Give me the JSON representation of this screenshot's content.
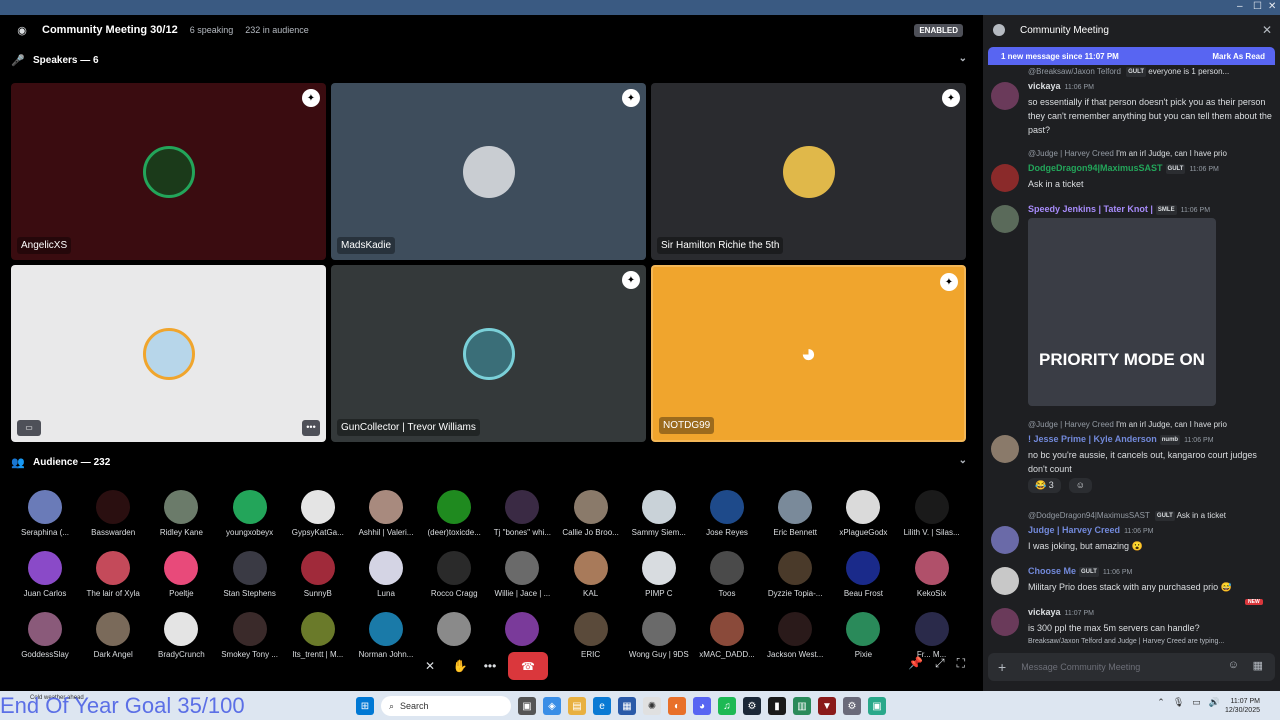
{
  "window": {
    "controls": [
      "–",
      "☐",
      "✕"
    ]
  },
  "stage": {
    "title": "Community Meeting 30/12",
    "speaking": "6 speaking",
    "audience": "232 in audience",
    "enabled_badge": "ENABLED",
    "speakers_heading": "Speakers — 6",
    "audience_heading": "Audience — 232"
  },
  "speakers": [
    {
      "name": "AngelicXS",
      "bg": "#3a0c10",
      "avatar": "#1b3a1a"
    },
    {
      "name": "MadsKadie",
      "bg": "#3e4d5c",
      "avatar": "#c9cdd2"
    },
    {
      "name": "Sir Hamilton Richie the 5th",
      "bg": "#2a2b2f",
      "avatar": "#e0b84a"
    },
    {
      "name": "",
      "bg": "#e9e9ea",
      "avatar": "#b7d6ea"
    },
    {
      "name": "GunCollector | Trevor Williams",
      "bg": "#34393a",
      "avatar": "#3a6e78"
    },
    {
      "name": "NOTDG99",
      "bg": "#f0a52d",
      "avatar": "#f0a52d"
    }
  ],
  "audience_rows": [
    [
      {
        "name": "Seraphina (...",
        "color": "#6a7bb8"
      },
      {
        "name": "Basswarden",
        "color": "#2a0f10"
      },
      {
        "name": "Ridley Kane",
        "color": "#6b7b6a"
      },
      {
        "name": "youngxobeyx",
        "color": "#23a55a"
      },
      {
        "name": "GypsyKatGa...",
        "color": "#e4e4e4"
      },
      {
        "name": "Ashhil | Valeri...",
        "color": "#a88a7e"
      },
      {
        "name": "(deer)toxicde...",
        "color": "#1f8a1f"
      },
      {
        "name": "Tj \"bones\" whi...",
        "color": "#3a2a44"
      },
      {
        "name": "Callie Jo Broo...",
        "color": "#8a7a6a"
      },
      {
        "name": "Sammy Siem...",
        "color": "#c9d2d8"
      },
      {
        "name": "Jose Reyes",
        "color": "#1e4a8a"
      },
      {
        "name": "Eric Bennett",
        "color": "#7a8a9a"
      },
      {
        "name": "xPlagueGodx",
        "color": "#dadada"
      },
      {
        "name": "Lilith V. | Silas...",
        "color": "#1a1a1a"
      }
    ],
    [
      {
        "name": "Juan Carlos",
        "color": "#8a4ac8"
      },
      {
        "name": "The lair of Xyla",
        "color": "#c44a5a"
      },
      {
        "name": "Poeltje",
        "color": "#e84a7a"
      },
      {
        "name": "Stan Stephens",
        "color": "#3a3a44"
      },
      {
        "name": "SunnyB",
        "color": "#a02a3a"
      },
      {
        "name": "Luna",
        "color": "#d4d4e4"
      },
      {
        "name": "Rocco Cragg",
        "color": "#2a2a2a"
      },
      {
        "name": "Willie | Jace | ...",
        "color": "#6a6a6a"
      },
      {
        "name": "KAL",
        "color": "#a87a5a"
      },
      {
        "name": "PIMP C",
        "color": "#d8dce0"
      },
      {
        "name": "Toos",
        "color": "#4a4a4a"
      },
      {
        "name": "Dyzzie Topia-...",
        "color": "#4a3a2a"
      },
      {
        "name": "Beau Frost",
        "color": "#1a2a8a"
      },
      {
        "name": "KekoSix",
        "color": "#b0506a"
      }
    ],
    [
      {
        "name": "GoddessSlay",
        "color": "#8a5a7a"
      },
      {
        "name": "Dark Angel",
        "color": "#7a6a5a"
      },
      {
        "name": "BradyCrunch",
        "color": "#e4e4e4"
      },
      {
        "name": "Smokey Tony ...",
        "color": "#3a2a2a"
      },
      {
        "name": "Its_trentt | M...",
        "color": "#6a7a2a"
      },
      {
        "name": "Norman John...",
        "color": "#1a7aa8"
      },
      {
        "name": "",
        "color": "#8a8a8a"
      },
      {
        "name": "",
        "color": "#7a3a9a"
      },
      {
        "name": "ERIC",
        "color": "#5a4a3a"
      },
      {
        "name": "Wong Guy | 9DS",
        "color": "#6a6a6a"
      },
      {
        "name": "xMAC_DADD...",
        "color": "#8a4a3a"
      },
      {
        "name": "Jackson West...",
        "color": "#2a1a1a"
      },
      {
        "name": "Pixie",
        "color": "#2a8a5a"
      },
      {
        "name": "Fr... M...",
        "color": "#2a2a4a"
      }
    ]
  ],
  "controls": {
    "mute": "✕",
    "raise_hand": "✋",
    "more": "•••",
    "leave": "☎"
  },
  "chat": {
    "title": "Community Meeting",
    "new_messages": "1 new message since 11:07 PM",
    "mark_read": "Mark As Read",
    "messages": [
      {
        "reply": "@Breaksaw/Jaxon Telford",
        "reply_tag": "GULT",
        "reply_text": "everyone is 1 person...",
        "user": "vickaya",
        "color": "#dbdee1",
        "time": "11:06 PM",
        "text": "so essentially if that person doesn't pick you as their person they can't remember anything but you can tell them about the past?"
      },
      {
        "reply": "@Judge | Harvey Creed",
        "reply_text": "I'm an irl Judge, can I have prio",
        "user": "DodgeDragon94|MaximusSAST",
        "color": "#23a55a",
        "tag": "GULT",
        "time": "11:06 PM",
        "text": "Ask in a ticket"
      },
      {
        "user": "Speedy Jenkins | Tater Knot |",
        "color": "#a78bfa",
        "tag": "SMLE",
        "time": "11:06 PM",
        "gif_text": "PRIORITY MODE ON"
      },
      {
        "reply": "@Judge | Harvey Creed",
        "reply_text": "I'm an irl Judge, can I have prio",
        "user": "! Jesse Prime | Kyle Anderson",
        "color": "#7289da",
        "tag": "numb",
        "time": "11:06 PM",
        "text": "no bc you're aussie, it cancels out, kangaroo court judges don't count",
        "reaction": "😂 3"
      },
      {
        "reply": "@DodgeDragon94|MaximusSAST",
        "reply_tag": "GULT",
        "reply_text": "Ask in a ticket",
        "user": "Judge | Harvey Creed",
        "color": "#7289da",
        "time": "11:06 PM",
        "text": "I was joking, but amazing 😮"
      },
      {
        "user": "Choose Me",
        "color": "#7289da",
        "tag": "GULT",
        "time": "11:06 PM",
        "text": "Military Prio does stack with any purchased prio 😅"
      },
      {
        "user": "vickaya",
        "color": "#dbdee1",
        "time": "11:07 PM",
        "text": "is 300 ppl the max 5m servers can handle?"
      }
    ],
    "new_pill": "NEW",
    "typing": "Breaksaw/Jaxon Telford and Judge | Harvey Creed are typing...",
    "composer_placeholder": "Message Community Meeting"
  },
  "taskbar": {
    "overlay": "End Of Year Goal 35/100",
    "weather": "Cold weather ahead",
    "search_placeholder": "Search",
    "time": "11:07 PM",
    "date": "12/30/2025"
  }
}
